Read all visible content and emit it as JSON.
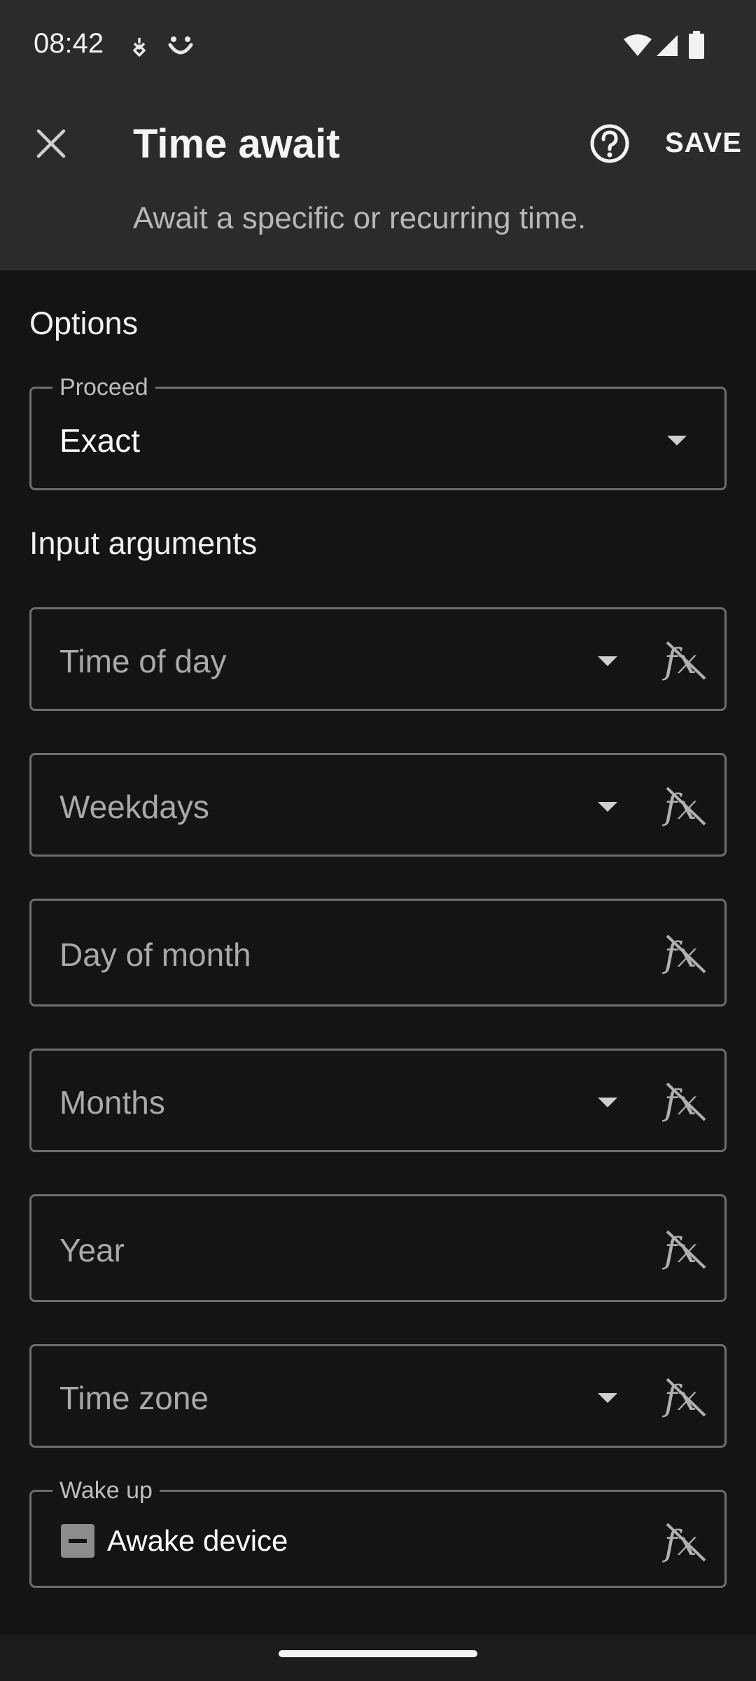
{
  "status_bar": {
    "time": "08:42",
    "icons": [
      "notification-app-icon",
      "smile-app-icon",
      "wifi-icon",
      "signal-icon",
      "battery-icon"
    ]
  },
  "app_bar": {
    "title": "Time await",
    "subtitle": "Await a specific or recurring time.",
    "save_label": "SAVE",
    "close_icon": "close-icon",
    "help_icon": "help-icon"
  },
  "options": {
    "section_title": "Options",
    "proceed": {
      "label": "Proceed",
      "value": "Exact"
    }
  },
  "inputs": {
    "section_title": "Input arguments",
    "time_of_day": {
      "placeholder": "Time of day"
    },
    "weekdays": {
      "placeholder": "Weekdays"
    },
    "day_of_month": {
      "placeholder": "Day of month"
    },
    "months": {
      "placeholder": "Months"
    },
    "year": {
      "placeholder": "Year"
    },
    "time_zone": {
      "placeholder": "Time zone"
    },
    "wake_up": {
      "label": "Wake up",
      "checkbox_label": "Awake device",
      "state": "indeterminate"
    }
  },
  "colors": {
    "appbar": "#2b2b2b",
    "background": "#141414",
    "outline": "#6d6d6d"
  }
}
